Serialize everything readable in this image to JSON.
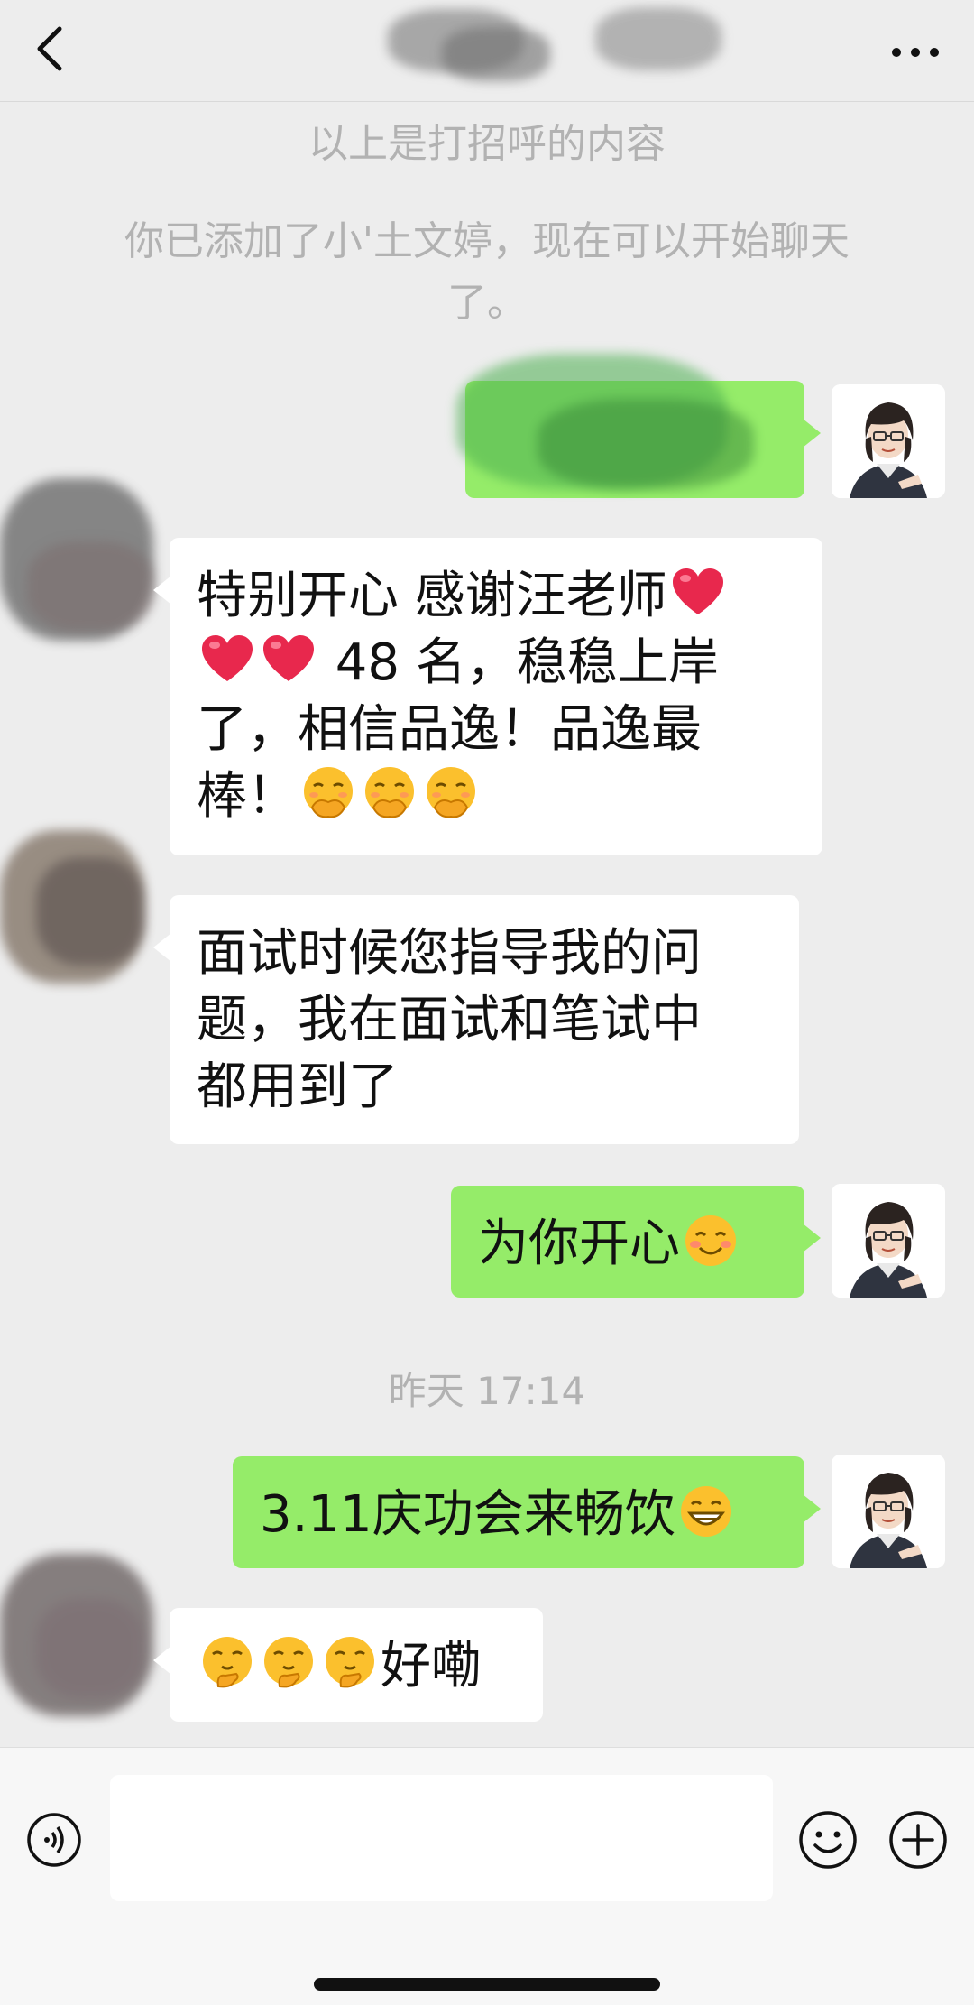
{
  "header": {
    "back_icon": "chevron-left-icon",
    "more_icon": "ellipsis-icon",
    "title_obscured": true
  },
  "notices": {
    "greeting_note": "以上是打招呼的内容",
    "added_note_line1": "你已添加了小'土文婷，现在可以开始聊天",
    "added_note_line2": "了。"
  },
  "messages": [
    {
      "id": "m1",
      "sender": "me",
      "text": "",
      "obscured": true
    },
    {
      "id": "m2",
      "sender": "other",
      "lines": [
        {
          "text": "特别开心 感谢汪老师",
          "trail_emojis": [
            "red-heart"
          ]
        },
        {
          "lead_emojis": [
            "red-heart",
            "red-heart"
          ],
          "text": " 48 名，稳稳上岸"
        },
        {
          "text": "了，相信品逸！品逸最"
        },
        {
          "text": "棒！",
          "trail_emojis": [
            "face-with-hand-over-mouth",
            "face-with-hand-over-mouth",
            "face-with-hand-over-mouth"
          ]
        }
      ]
    },
    {
      "id": "m3",
      "sender": "other",
      "lines": [
        {
          "text": "面试时候您指导我的问"
        },
        {
          "text": "题，我在面试和笔试中"
        },
        {
          "text": "都用到了"
        }
      ]
    },
    {
      "id": "m4",
      "sender": "me",
      "text": "为你开心",
      "trail_emojis": [
        "smiling-face"
      ]
    },
    {
      "id": "m5",
      "sender": "me",
      "text": "3.11庆功会来畅饮",
      "trail_emojis": [
        "grinning-face"
      ]
    },
    {
      "id": "m6",
      "sender": "other",
      "lead_emojis": [
        "thinking-face",
        "thinking-face",
        "thinking-face"
      ],
      "text": "好嘞"
    }
  ],
  "timestamp": "昨天 17:14",
  "inputbar": {
    "voice_icon": "voice-icon",
    "text_value": "",
    "emoji_icon": "emoji-icon",
    "plus_icon": "plus-icon"
  },
  "colors": {
    "background": "#ededed",
    "bubble_me": "#95ec69",
    "bubble_other": "#ffffff",
    "notice_text": "#b2b2b2"
  }
}
